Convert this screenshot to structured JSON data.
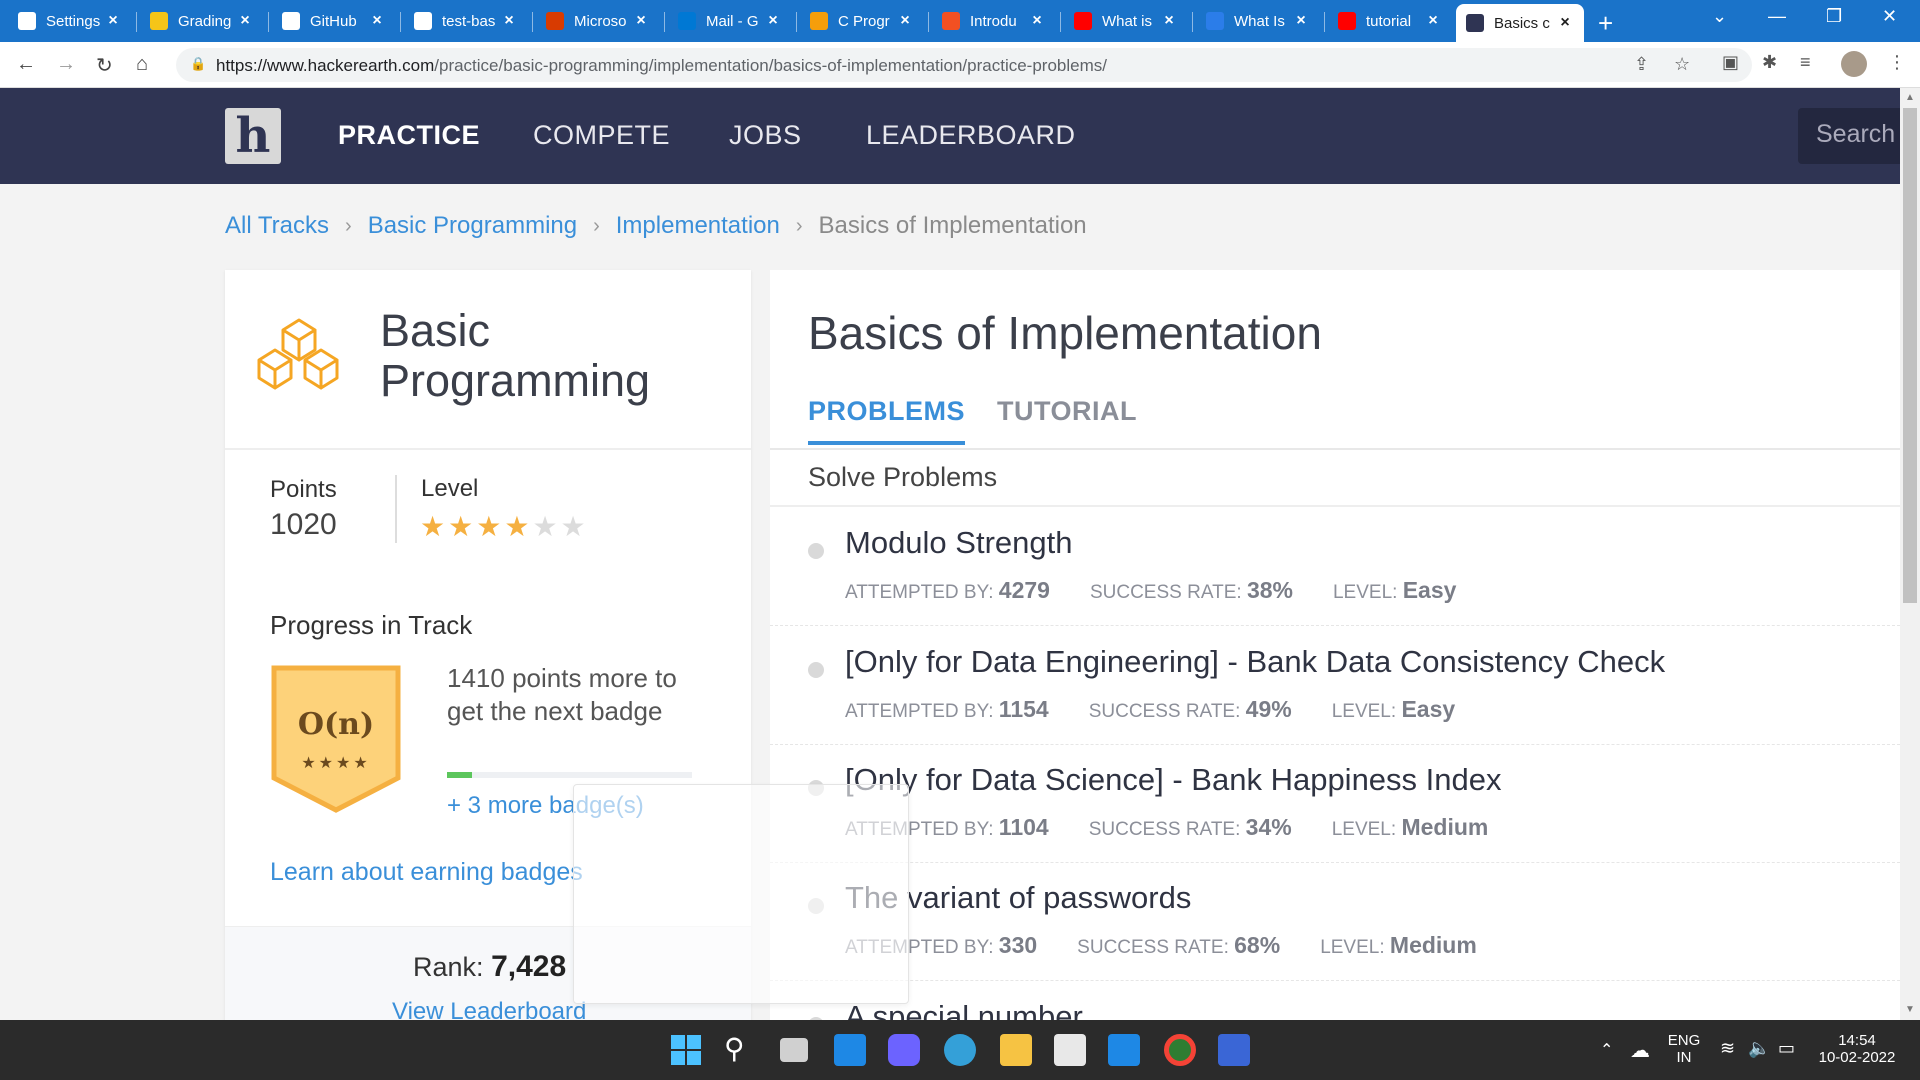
{
  "browser": {
    "tabs": [
      {
        "title": "Settings",
        "icon": "gear-icon",
        "color": "#ffffff"
      },
      {
        "title": "Grading",
        "icon": "duck-icon",
        "color": "#f5c518"
      },
      {
        "title": "GitHub",
        "icon": "github-icon",
        "color": "#ffffff"
      },
      {
        "title": "test-bas",
        "icon": "github-icon",
        "color": "#ffffff"
      },
      {
        "title": "Microso",
        "icon": "office-icon",
        "color": "#d83b01"
      },
      {
        "title": "Mail - G",
        "icon": "outlook-icon",
        "color": "#0078d4"
      },
      {
        "title": "C Progr",
        "icon": "in-icon",
        "color": "#f59e0b"
      },
      {
        "title": "Introdu",
        "icon": "windows-icon",
        "color": "#f25022"
      },
      {
        "title": "What is",
        "icon": "youtube-icon",
        "color": "#ff0000"
      },
      {
        "title": "What Is",
        "icon": "e-icon",
        "color": "#2b7de9"
      },
      {
        "title": "tutorial",
        "icon": "youtube-icon",
        "color": "#ff0000"
      },
      {
        "title": "Basics c",
        "icon": "hackerearth-icon",
        "color": "#2f3453"
      }
    ],
    "url_host": "https://www.hackerearth.com",
    "url_path": "/practice/basic-programming/implementation/basics-of-implementation/practice-problems/"
  },
  "site": {
    "logo": "h",
    "nav": {
      "practice": "PRACTICE",
      "compete": "COMPETE",
      "jobs": "JOBS",
      "leaderboard": "LEADERBOARD"
    },
    "search_placeholder": "Search"
  },
  "breadcrumb": {
    "all_tracks": "All Tracks",
    "basic_programming": "Basic Programming",
    "implementation": "Implementation",
    "current": "Basics of Implementation",
    "separator": "›"
  },
  "track": {
    "title_line1": "Basic",
    "title_line2": "Programming",
    "points_label": "Points",
    "points_value": "1020",
    "level_label": "Level",
    "level_stars_filled": 4,
    "level_stars_total": 6,
    "progress_title": "Progress in Track",
    "badge_label": "O(n)",
    "badge_stars": "★★★★",
    "next_badge_text": "1410 points more to get the next badge",
    "progress_fraction": 0.1,
    "more_badges": "+ 3 more badge(s)",
    "learn_badges": "Learn about earning badges",
    "rank_label": "Rank:",
    "rank_value": "7,428",
    "view_leaderboard": "View Leaderboard",
    "accent_color": "#f5a623"
  },
  "main": {
    "title": "Basics of Implementation",
    "tab_problems": "PROBLEMS",
    "tab_tutorial": "TUTORIAL",
    "solve_heading": "Solve Problems",
    "labels": {
      "attempted": "ATTEMPTED BY:",
      "success": "SUCCESS RATE:",
      "level": "LEVEL:"
    },
    "problems": [
      {
        "name": "Modulo Strength",
        "attempted": "4279",
        "success": "38%",
        "level": "Easy"
      },
      {
        "name": "[Only for Data Engineering] - Bank Data Consistency Check",
        "attempted": "1154",
        "success": "49%",
        "level": "Easy"
      },
      {
        "name": "[Only for Data Science] - Bank Happiness Index",
        "attempted": "1104",
        "success": "34%",
        "level": "Medium"
      },
      {
        "name": "The variant of passwords",
        "attempted": "330",
        "success": "68%",
        "level": "Medium"
      },
      {
        "name": "A special number",
        "attempted": "",
        "success": "",
        "level": ""
      }
    ]
  },
  "taskbar": {
    "lang_line1": "ENG",
    "lang_line2": "IN",
    "time": "14:54",
    "date": "10-02-2022"
  }
}
